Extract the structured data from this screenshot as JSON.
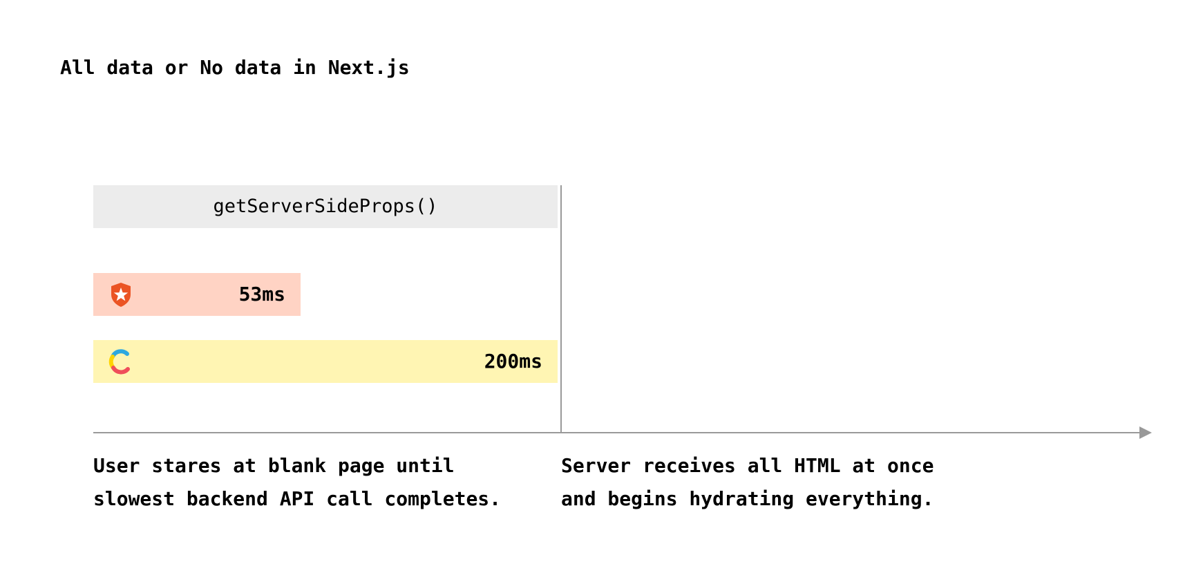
{
  "title": "All data or No data in Next.js",
  "server_block": {
    "label": "getServerSideProps()",
    "color": "#ececec"
  },
  "api_calls": [
    {
      "icon": "auth0-shield-icon",
      "duration": "53ms",
      "color": "#ffd3c4",
      "icon_color": "#eb5424"
    },
    {
      "icon": "contentful-c-icon",
      "duration": "200ms",
      "color": "#fff5b3"
    }
  ],
  "captions": {
    "left": [
      "User stares at blank page until",
      "slowest backend API call completes."
    ],
    "right": [
      "Server receives all HTML at once",
      "and begins hydrating everything."
    ]
  },
  "colors": {
    "axis": "#999999"
  }
}
